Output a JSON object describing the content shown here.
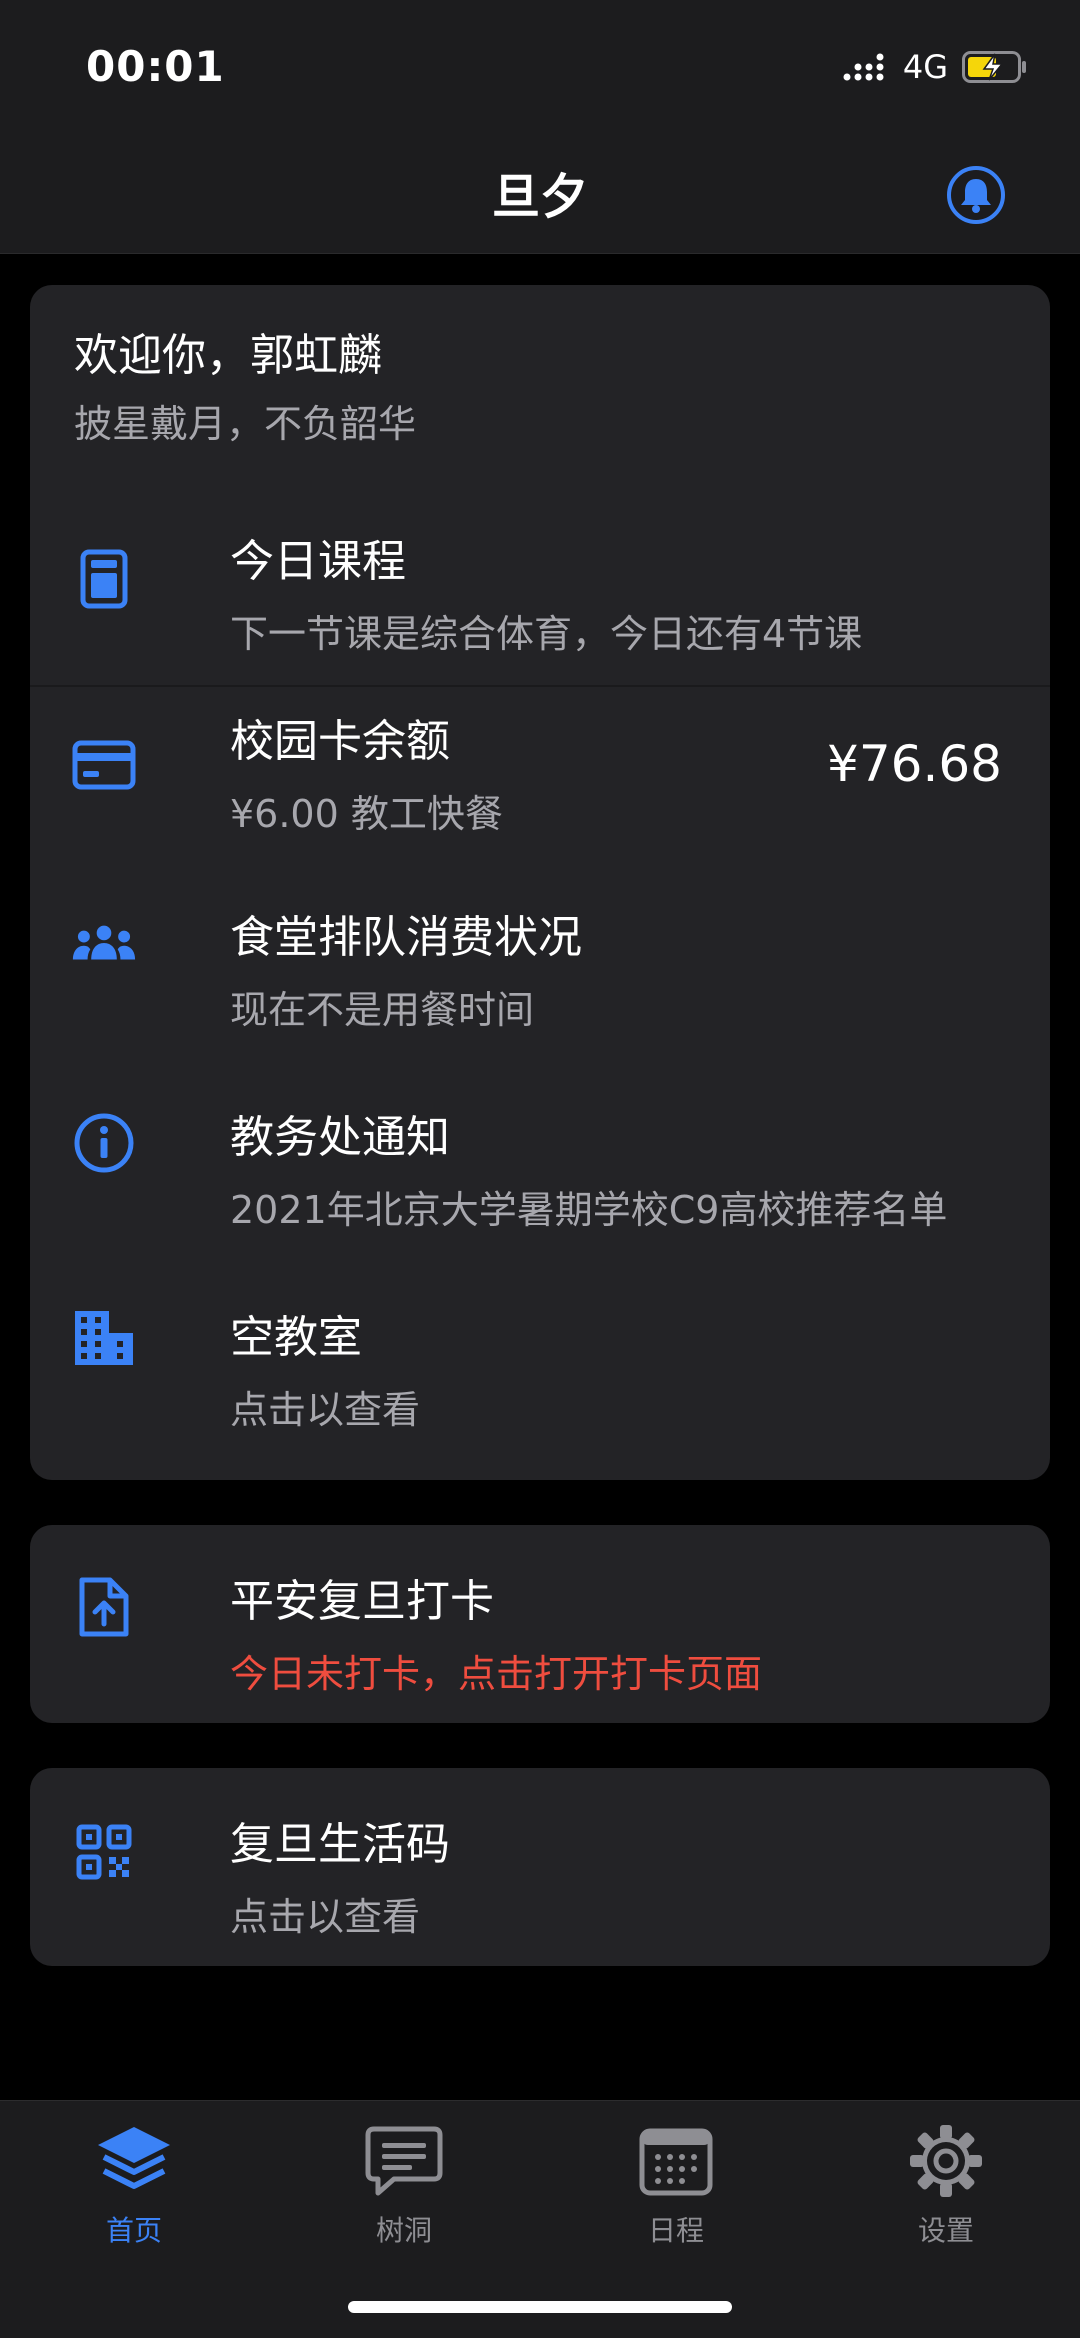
{
  "status_bar": {
    "time": "00:01",
    "network": "4G"
  },
  "header": {
    "title": "旦夕"
  },
  "welcome": {
    "title": "欢迎你，郭虹麟",
    "subtitle": "披星戴月，不负韶华"
  },
  "items": [
    {
      "title": "今日课程",
      "subtitle": "下一节课是综合体育，今日还有4节课",
      "icon": "book-icon"
    },
    {
      "title": "校园卡余额",
      "subtitle": "¥6.00 教工快餐",
      "value": "¥76.68",
      "icon": "credit-card-icon"
    },
    {
      "title": "食堂排队消费状况",
      "subtitle": "现在不是用餐时间",
      "icon": "people-icon"
    },
    {
      "title": "教务处通知",
      "subtitle": "2021年北京大学暑期学校C9高校推荐名单",
      "icon": "info-icon"
    },
    {
      "title": "空教室",
      "subtitle": "点击以查看",
      "icon": "building-icon"
    }
  ],
  "checkin": {
    "title": "平安复旦打卡",
    "subtitle": "今日未打卡，点击打开打卡页面",
    "icon": "file-upload-icon"
  },
  "lifecode": {
    "title": "复旦生活码",
    "subtitle": "点击以查看",
    "icon": "qr-code-icon"
  },
  "tabs": [
    {
      "label": "首页",
      "icon": "layers-icon",
      "active": true
    },
    {
      "label": "树洞",
      "icon": "chat-icon",
      "active": false
    },
    {
      "label": "日程",
      "icon": "calendar-icon",
      "active": false
    },
    {
      "label": "设置",
      "icon": "gear-icon",
      "active": false
    }
  ],
  "colors": {
    "accent": "#3b82f6",
    "warning": "#ef4d3f",
    "card": "#232326",
    "background": "#000000",
    "battery": "#f5d60a"
  }
}
